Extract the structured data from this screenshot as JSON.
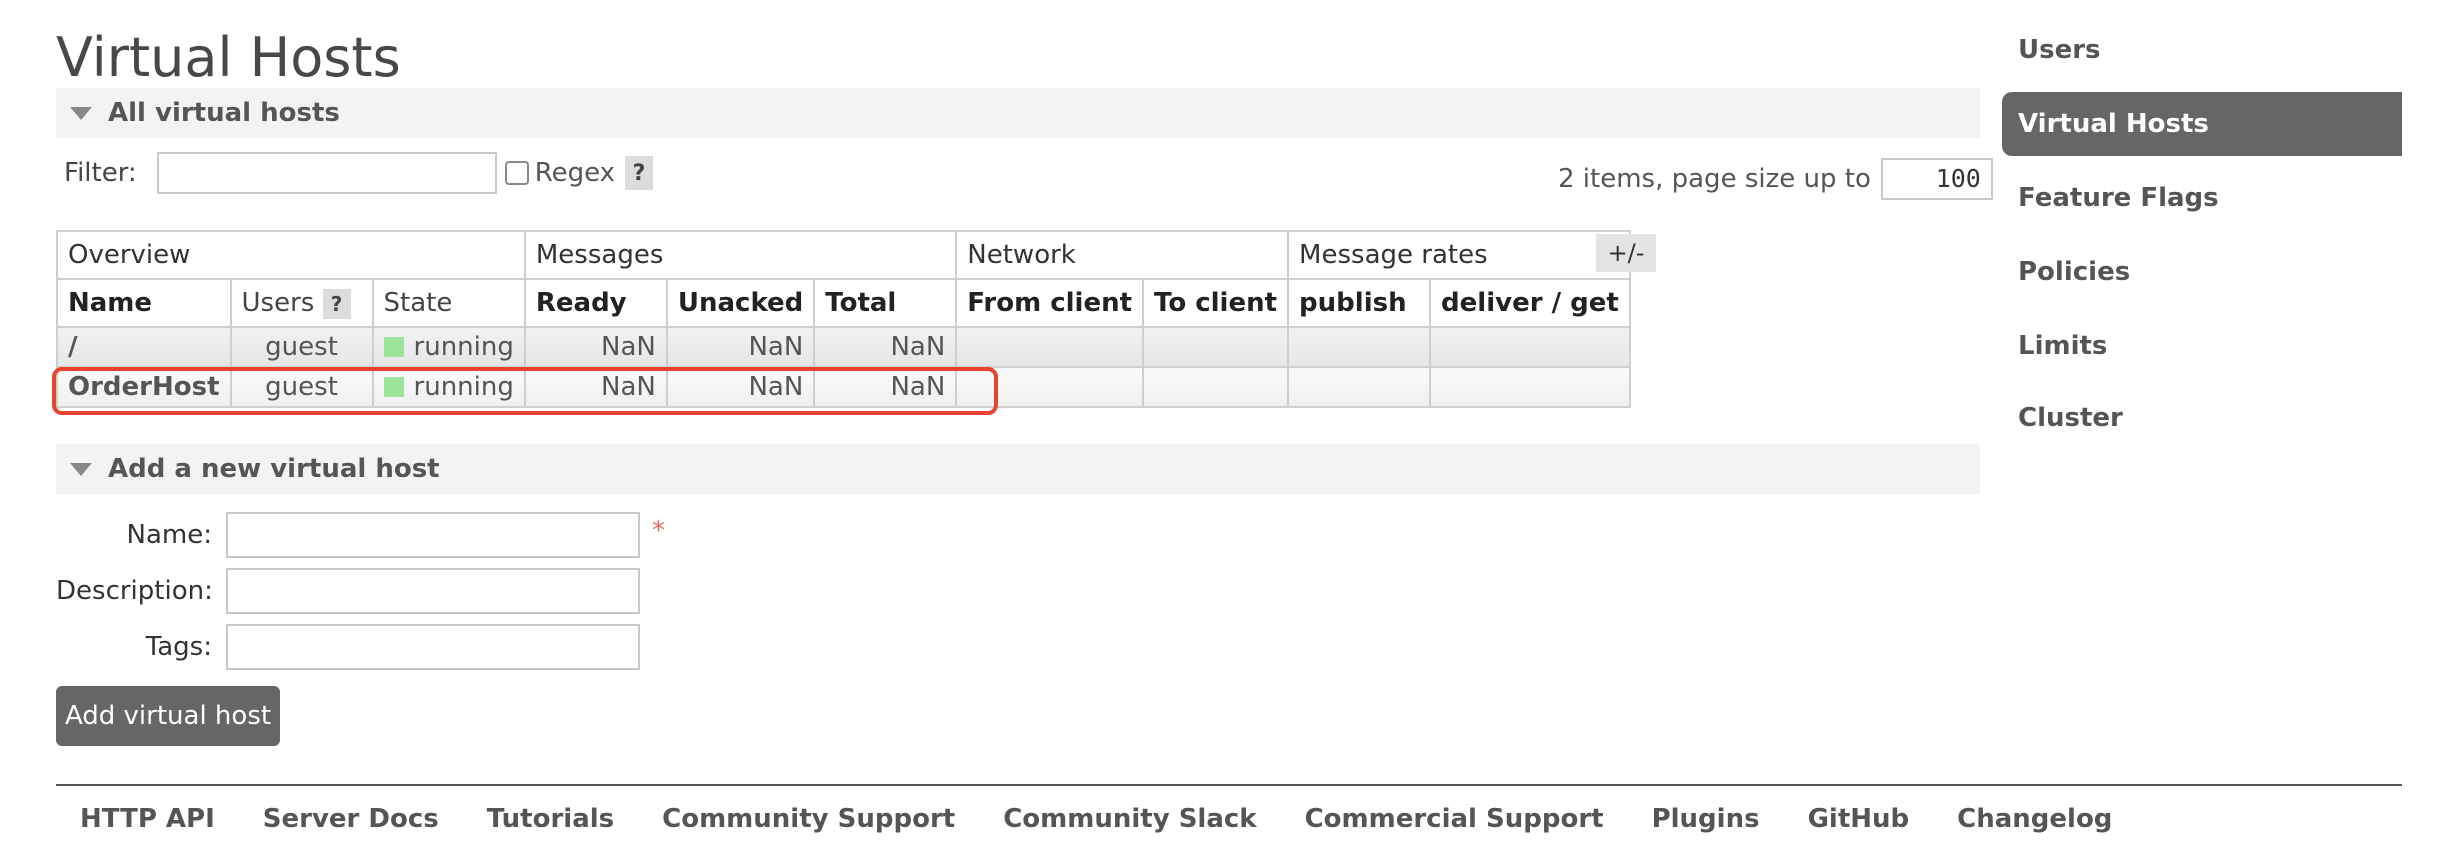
{
  "page": {
    "title": "Virtual Hosts"
  },
  "all_section": {
    "label": "All virtual hosts"
  },
  "filter": {
    "label": "Filter:",
    "value": "",
    "regex_label": "Regex",
    "help": "?"
  },
  "paging": {
    "text": "2 items, page size up to",
    "page_size": "100"
  },
  "table": {
    "groups": [
      "Overview",
      "Messages",
      "Network",
      "Message rates"
    ],
    "columns": [
      "Name",
      "Users",
      "State",
      "Ready",
      "Unacked",
      "Total",
      "From client",
      "To client",
      "publish",
      "deliver / get"
    ],
    "users_help": "?",
    "toggle_label": "+/-",
    "rows": [
      {
        "name": "/",
        "users": "guest",
        "state": "running",
        "ready": "NaN",
        "unacked": "NaN",
        "total": "NaN",
        "from_client": "",
        "to_client": "",
        "publish": "",
        "deliver_get": ""
      },
      {
        "name": "OrderHost",
        "users": "guest",
        "state": "running",
        "ready": "NaN",
        "unacked": "NaN",
        "total": "NaN",
        "from_client": "",
        "to_client": "",
        "publish": "",
        "deliver_get": ""
      }
    ]
  },
  "add_section": {
    "label": "Add a new virtual host"
  },
  "form": {
    "name_label": "Name:",
    "name_value": "",
    "required_mark": "*",
    "description_label": "Description:",
    "description_value": "",
    "tags_label": "Tags:",
    "tags_value": "",
    "submit_label": "Add virtual host"
  },
  "footer": {
    "links": [
      "HTTP API",
      "Server Docs",
      "Tutorials",
      "Community Support",
      "Community Slack",
      "Commercial Support",
      "Plugins",
      "GitHub",
      "Changelog"
    ]
  },
  "sidebar": {
    "items": [
      {
        "label": "Users",
        "active": false
      },
      {
        "label": "Virtual Hosts",
        "active": true
      },
      {
        "label": "Feature Flags",
        "active": false
      },
      {
        "label": "Policies",
        "active": false
      },
      {
        "label": "Limits",
        "active": false
      },
      {
        "label": "Cluster",
        "active": false
      }
    ]
  },
  "colors": {
    "state_running": "#9be59b",
    "highlight": "#e8432e",
    "active_nav": "#666666"
  }
}
